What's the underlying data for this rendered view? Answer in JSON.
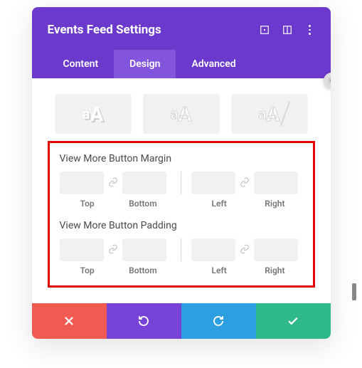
{
  "header": {
    "title": "Events Feed Settings"
  },
  "tabs": {
    "content": "Content",
    "design": "Design",
    "advanced": "Advanced"
  },
  "styles": {
    "sample_small": "a",
    "sample_big": "A"
  },
  "margin": {
    "title": "View More Button Margin",
    "top": "Top",
    "bottom": "Bottom",
    "left": "Left",
    "right": "Right"
  },
  "padding": {
    "title": "View More Button Padding",
    "top": "Top",
    "bottom": "Bottom",
    "left": "Left",
    "right": "Right"
  }
}
